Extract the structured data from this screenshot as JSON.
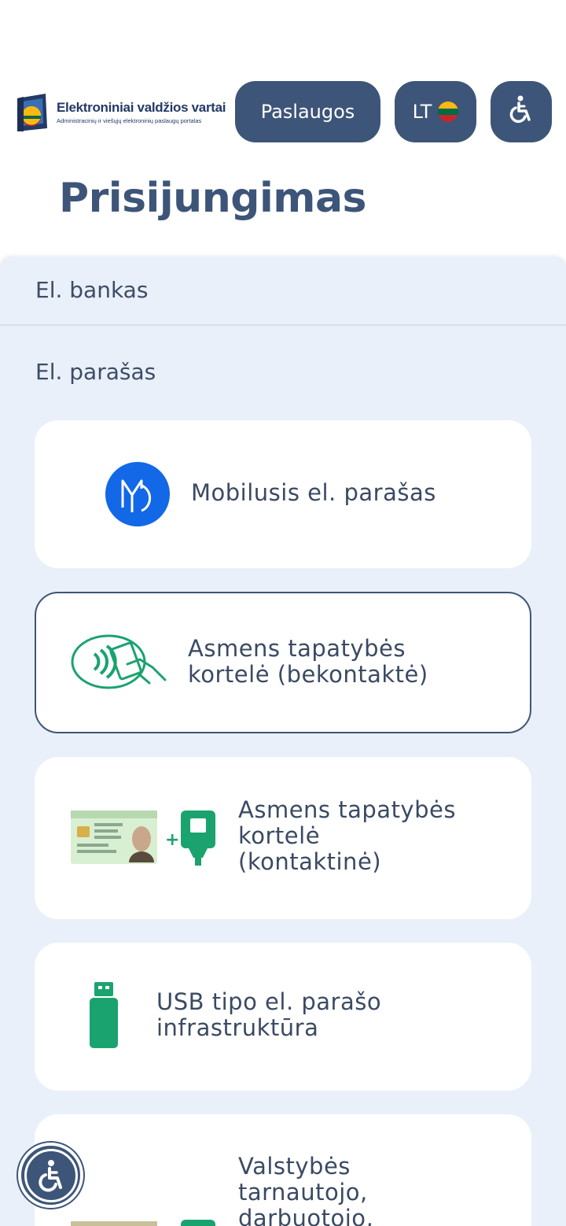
{
  "header": {
    "logo_title": "Elektroniniai valdžios vartai",
    "logo_subtitle": "Administracinių ir viešųjų elektroninių paslaugų portalas",
    "services_label": "Paslaugos",
    "language_label": "LT",
    "flag_colors": [
      "#fdb913",
      "#006a44",
      "#c1272d"
    ],
    "accessibility_icon": "wheelchair-icon"
  },
  "page": {
    "title": "Prisijungimas"
  },
  "sections": {
    "bank_label": "El. bankas",
    "signature_label": "El. parašas"
  },
  "methods": [
    {
      "label": "Mobilusis el. parašas",
      "icon": "mobile-signature-icon",
      "selected": false
    },
    {
      "label": "Asmens tapatybės\nkortelė (bekontaktė)",
      "icon": "contactless-card-icon",
      "selected": true
    },
    {
      "label": "Asmens tapatybės\nkortelė\n(kontaktinė)",
      "icon": "id-card-reader-icon",
      "selected": false
    },
    {
      "label": "USB tipo el. parašo\ninfrastruktūra",
      "icon": "usb-token-icon",
      "selected": false
    },
    {
      "label": "Valstybės\ntarnautojo,\ndarbuotojo,",
      "icon": "civil-servant-card-icon",
      "selected": false
    }
  ],
  "colors": {
    "primary": "#3d5578",
    "panel_bg": "#e9f0f9",
    "green": "#1aa36f",
    "mobile_blue": "#1268e6"
  },
  "floating_accessibility_icon": "accessibility-icon"
}
